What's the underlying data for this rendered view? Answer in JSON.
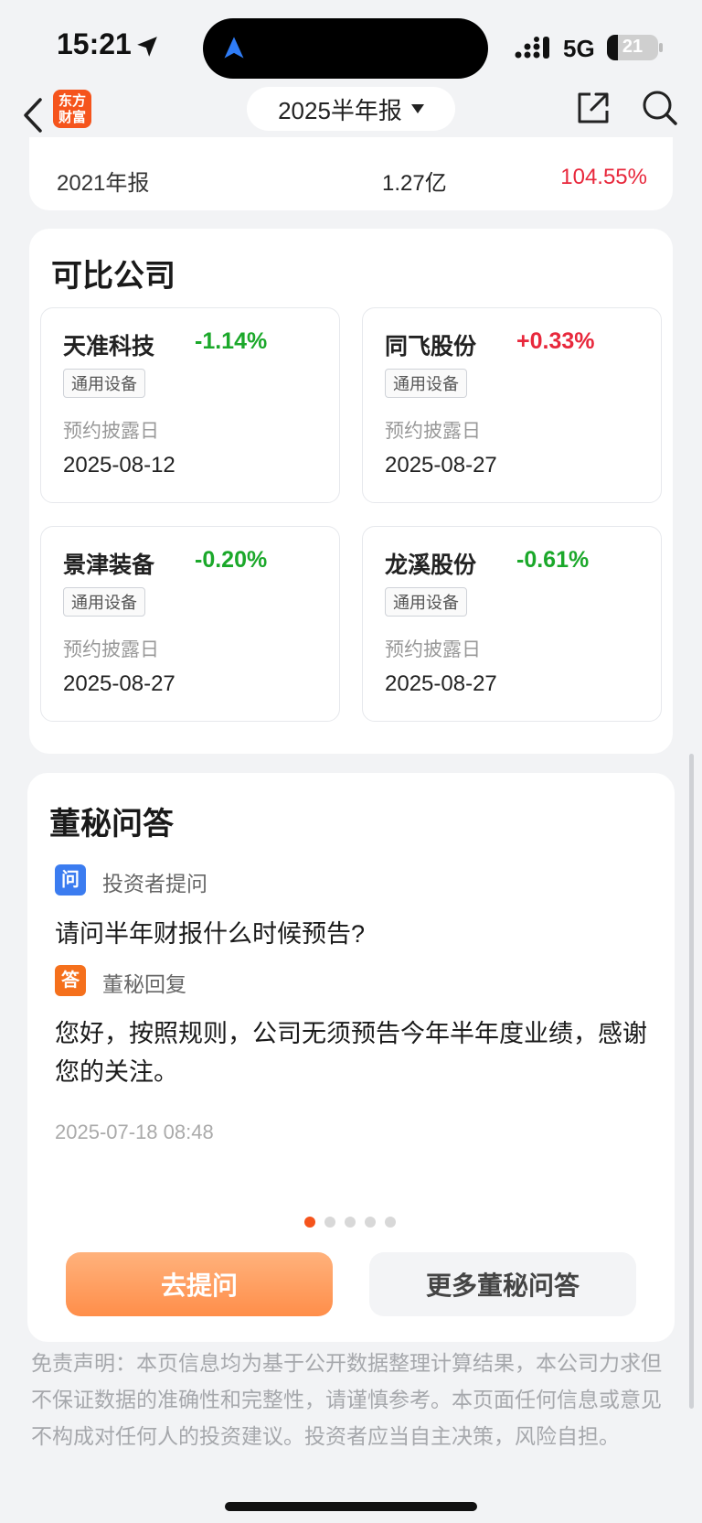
{
  "status": {
    "time": "15:21",
    "network": "5G",
    "battery": "21",
    "battery_fraction": 0.21
  },
  "nav": {
    "logo_text": "东方财富",
    "report_period": "2025半年报"
  },
  "history_row": {
    "label": "2021年报",
    "value": "1.27亿",
    "change": "104.55%"
  },
  "peers": {
    "title": "可比公司",
    "items": [
      {
        "name": "天准科技",
        "change": "-1.14%",
        "tag": "通用设备",
        "date_label": "预约披露日",
        "date": "2025-08-12"
      },
      {
        "name": "同飞股份",
        "change": "+0.33%",
        "tag": "通用设备",
        "date_label": "预约披露日",
        "date": "2025-08-27"
      },
      {
        "name": "景津装备",
        "change": "-0.20%",
        "tag": "通用设备",
        "date_label": "预约披露日",
        "date": "2025-08-27"
      },
      {
        "name": "龙溪股份",
        "change": "-0.61%",
        "tag": "通用设备",
        "date_label": "预约披露日",
        "date": "2025-08-27"
      }
    ]
  },
  "qa": {
    "title": "董秘问答",
    "question_badge": "问",
    "question_label": "投资者提问",
    "question": "请问半年财报什么时候预告?",
    "answer_badge": "答",
    "answer_label": "董秘回复",
    "answer": "您好，按照规则，公司无须预告今年半年度业绩，感谢您的关注。",
    "time": "2025-07-18 08:48",
    "page_count": 5,
    "active_page": 1,
    "ask_button": "去提问",
    "more_button": "更多董秘问答"
  },
  "disclaimer": "免责声明：本页信息均为基于公开数据整理计算结果，本公司力求但不保证数据的准确性和完整性，请谨慎参考。本页面任何信息或意见不构成对任何人的投资建议。投资者应当自主决策，风险自担。",
  "colors": {
    "accent": "#f5541c",
    "up": "#e8283c",
    "down": "#1ba82a",
    "question_blue": "#3b7cf0",
    "answer_orange": "#f5701c"
  },
  "icons": [
    "location-arrow-icon",
    "signal-icon",
    "battery-icon",
    "back-icon",
    "share-icon",
    "search-icon",
    "caret-down-icon"
  ]
}
